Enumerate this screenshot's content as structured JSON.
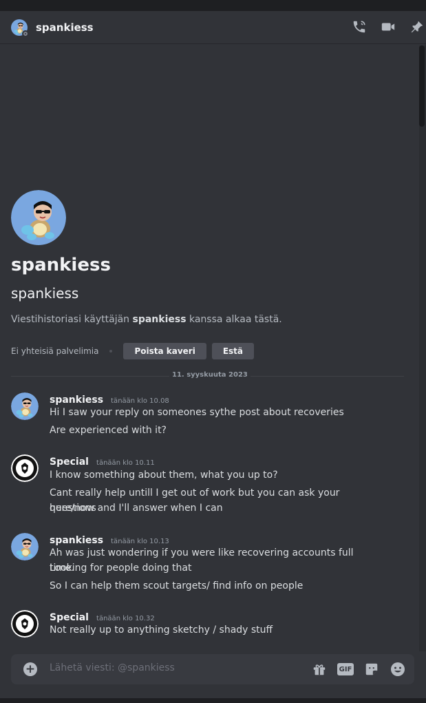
{
  "header": {
    "username": "spankiess",
    "icons": [
      "phone-call-icon",
      "video-camera-icon",
      "pin-icon"
    ]
  },
  "intro": {
    "display_name": "spankiess",
    "username": "spankiess",
    "history_prefix": "Viestihistoriasi käyttäjän ",
    "history_user": "spankiess",
    "history_suffix": " kanssa alkaa tästä.",
    "mutual_servers": "Ei yhteisiä palvelimia",
    "remove_friend_label": "Poista kaveri",
    "block_label": "Estä"
  },
  "date_divider": "11. syyskuuta 2023",
  "messages": [
    {
      "author": "spankiess",
      "time": "tänään klo 10.08",
      "lines": [
        "Hi I saw your reply on someones sythe post about recoveries",
        "Are experienced with it?"
      ]
    },
    {
      "author": "Special",
      "time": "tänään klo 10.11",
      "lines": [
        "I know something about them, what you up to?",
        "Cant really help untill I get out of work but you can ask your questions",
        "here/now and I'll answer when I can"
      ]
    },
    {
      "author": "spankiess",
      "time": "tänään klo 10.13",
      "lines": [
        "Ah was just wondering if you were like recovering accounts full time.",
        "Looking for people doing that",
        "So I can help them scout targets/ find info on people"
      ]
    },
    {
      "author": "Special",
      "time": "tänään klo 10.32",
      "lines": [
        "Not really up to anything sketchy / shady stuff"
      ]
    }
  ],
  "composer": {
    "placeholder": "Lähetä viesti: @spankiess",
    "gif_label": "GIF",
    "icons": [
      "add-attachment-icon",
      "gift-icon",
      "gif-icon",
      "sticker-icon",
      "emoji-icon"
    ]
  },
  "colors": {
    "background": "#313338",
    "header_bg": "#313338",
    "composer_bg": "#383a40",
    "avatar_blue": "#7aa7e0"
  }
}
